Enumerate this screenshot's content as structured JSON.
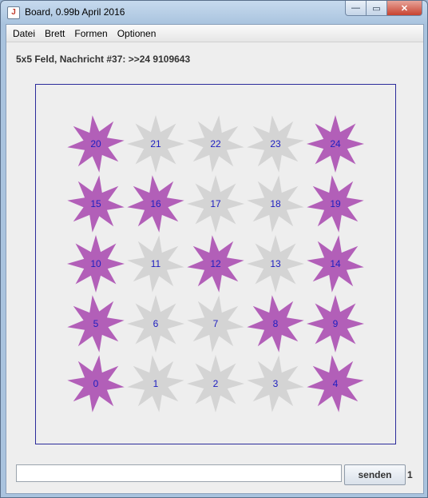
{
  "window": {
    "title": "Board, 0.99b April 2016",
    "app_icon_glyph": "J",
    "minimize_glyph": "—",
    "maximize_glyph": "▭",
    "close_glyph": "✕"
  },
  "menu": [
    "Datei",
    "Brett",
    "Formen",
    "Optionen"
  ],
  "status_text": "5x5 Feld, Nachricht #37: >>24 9109643",
  "board": {
    "columns": 5,
    "rows": 5,
    "colors": {
      "purple": "#b25fb8",
      "gray": "#d4d4d4",
      "label": "#2020c0",
      "border": "#2a2a9a"
    },
    "cells_top_to_bottom": [
      [
        {
          "n": "20",
          "c": "purple"
        },
        {
          "n": "21",
          "c": "gray"
        },
        {
          "n": "22",
          "c": "gray"
        },
        {
          "n": "23",
          "c": "gray"
        },
        {
          "n": "24",
          "c": "purple"
        }
      ],
      [
        {
          "n": "15",
          "c": "purple"
        },
        {
          "n": "16",
          "c": "purple"
        },
        {
          "n": "17",
          "c": "gray"
        },
        {
          "n": "18",
          "c": "gray"
        },
        {
          "n": "19",
          "c": "purple"
        }
      ],
      [
        {
          "n": "10",
          "c": "purple"
        },
        {
          "n": "11",
          "c": "gray"
        },
        {
          "n": "12",
          "c": "purple"
        },
        {
          "n": "13",
          "c": "gray"
        },
        {
          "n": "14",
          "c": "purple"
        }
      ],
      [
        {
          "n": "5",
          "c": "purple"
        },
        {
          "n": "6",
          "c": "gray"
        },
        {
          "n": "7",
          "c": "gray"
        },
        {
          "n": "8",
          "c": "purple"
        },
        {
          "n": "9",
          "c": "purple"
        }
      ],
      [
        {
          "n": "0",
          "c": "purple"
        },
        {
          "n": "1",
          "c": "gray"
        },
        {
          "n": "2",
          "c": "gray"
        },
        {
          "n": "3",
          "c": "gray"
        },
        {
          "n": "4",
          "c": "purple"
        }
      ]
    ],
    "shape": "star-8-point"
  },
  "input": {
    "value": "",
    "placeholder": ""
  },
  "send_label": "senden",
  "counter": "1"
}
